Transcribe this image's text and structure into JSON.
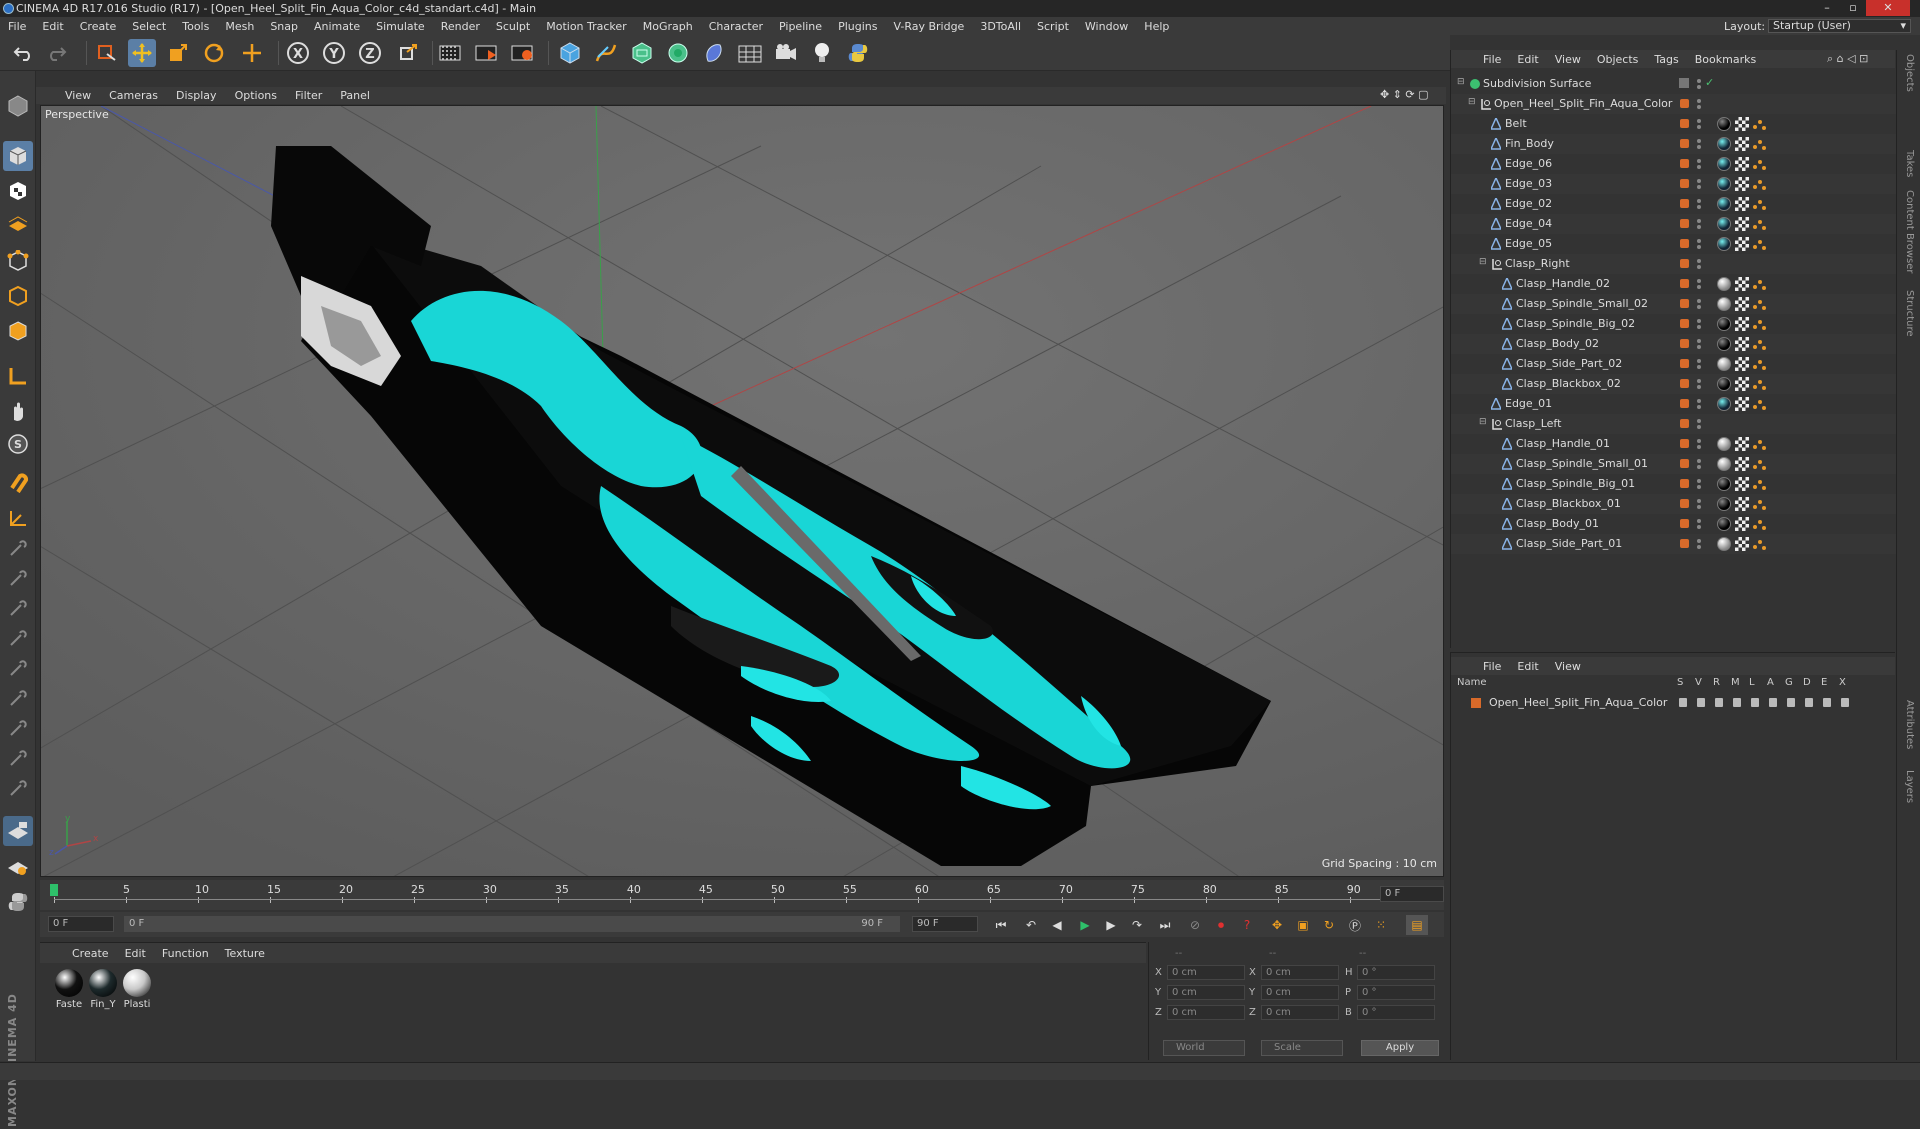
{
  "window": {
    "title": "CINEMA 4D R17.016 Studio (R17) - [Open_Heel_Split_Fin_Aqua_Color_c4d_standart.c4d] - Main",
    "controls": [
      "–",
      "▫",
      "✕"
    ]
  },
  "menu": [
    "File",
    "Edit",
    "Create",
    "Select",
    "Tools",
    "Mesh",
    "Snap",
    "Animate",
    "Simulate",
    "Render",
    "Sculpt",
    "Motion Tracker",
    "MoGraph",
    "Character",
    "Pipeline",
    "Plugins",
    "V-Ray Bridge",
    "3DToAll",
    "Script",
    "Window",
    "Help"
  ],
  "layout": {
    "label": "Layout:",
    "value": "Startup (User)"
  },
  "viewport": {
    "menu": [
      "View",
      "Cameras",
      "Display",
      "Options",
      "Filter",
      "Panel"
    ],
    "label": "Perspective",
    "grid_spacing": "Grid Spacing : 10 cm",
    "axis_labels": [
      "y",
      "x",
      "z"
    ]
  },
  "timeline": {
    "ticks": [
      "0",
      "5",
      "10",
      "15",
      "20",
      "25",
      "30",
      "35",
      "40",
      "45",
      "50",
      "55",
      "60",
      "65",
      "70",
      "75",
      "80",
      "85",
      "90"
    ],
    "current_frame": "0 F",
    "start_field": "0 F",
    "range_start": "0 F",
    "range_end": "90 F",
    "end_field": "90 F"
  },
  "material_panel": {
    "menu": [
      "Create",
      "Edit",
      "Function",
      "Texture"
    ],
    "materials": [
      {
        "name": "Faste",
        "color": "#111111"
      },
      {
        "name": "Fin_Y",
        "color": "#1d2a2c"
      },
      {
        "name": "Plasti",
        "color": "#c8c8c8"
      }
    ]
  },
  "coords": {
    "header": [
      "--",
      "--",
      "--"
    ],
    "rows": [
      {
        "a": "X",
        "av": "0 cm",
        "b": "X",
        "bv": "0 cm",
        "c": "H",
        "cv": "0 °"
      },
      {
        "a": "Y",
        "av": "0 cm",
        "b": "Y",
        "bv": "0 cm",
        "c": "P",
        "cv": "0 °"
      },
      {
        "a": "Z",
        "av": "0 cm",
        "b": "Z",
        "bv": "0 cm",
        "c": "B",
        "cv": "0 °"
      }
    ],
    "world": "World",
    "scale": "Scale",
    "apply": "Apply"
  },
  "object_manager": {
    "menu": [
      "File",
      "Edit",
      "View",
      "Objects",
      "Tags",
      "Bookmarks"
    ],
    "objects": [
      {
        "name": "Subdivision Surface",
        "depth": 0,
        "type": "sds",
        "tag": "none"
      },
      {
        "name": "Open_Heel_Split_Fin_Aqua_Color",
        "depth": 1,
        "type": "null",
        "tag": "none"
      },
      {
        "name": "Belt",
        "depth": 2,
        "type": "poly",
        "tag": "black"
      },
      {
        "name": "Fin_Body",
        "depth": 2,
        "type": "poly",
        "tag": "teal"
      },
      {
        "name": "Edge_06",
        "depth": 2,
        "type": "poly",
        "tag": "teal"
      },
      {
        "name": "Edge_03",
        "depth": 2,
        "type": "poly",
        "tag": "teal"
      },
      {
        "name": "Edge_02",
        "depth": 2,
        "type": "poly",
        "tag": "teal"
      },
      {
        "name": "Edge_04",
        "depth": 2,
        "type": "poly",
        "tag": "teal"
      },
      {
        "name": "Edge_05",
        "depth": 2,
        "type": "poly",
        "tag": "teal"
      },
      {
        "name": "Clasp_Right",
        "depth": 2,
        "type": "null",
        "tag": "none"
      },
      {
        "name": "Clasp_Handle_02",
        "depth": 3,
        "type": "poly",
        "tag": "grey"
      },
      {
        "name": "Clasp_Spindle_Small_02",
        "depth": 3,
        "type": "poly",
        "tag": "grey"
      },
      {
        "name": "Clasp_Spindle_Big_02",
        "depth": 3,
        "type": "poly",
        "tag": "black"
      },
      {
        "name": "Clasp_Body_02",
        "depth": 3,
        "type": "poly",
        "tag": "black"
      },
      {
        "name": "Clasp_Side_Part_02",
        "depth": 3,
        "type": "poly",
        "tag": "grey"
      },
      {
        "name": "Clasp_Blackbox_02",
        "depth": 3,
        "type": "poly",
        "tag": "black"
      },
      {
        "name": "Edge_01",
        "depth": 2,
        "type": "poly",
        "tag": "teal"
      },
      {
        "name": "Clasp_Left",
        "depth": 2,
        "type": "null",
        "tag": "none"
      },
      {
        "name": "Clasp_Handle_01",
        "depth": 3,
        "type": "poly",
        "tag": "grey"
      },
      {
        "name": "Clasp_Spindle_Small_01",
        "depth": 3,
        "type": "poly",
        "tag": "grey"
      },
      {
        "name": "Clasp_Spindle_Big_01",
        "depth": 3,
        "type": "poly",
        "tag": "black"
      },
      {
        "name": "Clasp_Blackbox_01",
        "depth": 3,
        "type": "poly",
        "tag": "black"
      },
      {
        "name": "Clasp_Body_01",
        "depth": 3,
        "type": "poly",
        "tag": "black"
      },
      {
        "name": "Clasp_Side_Part_01",
        "depth": 3,
        "type": "poly",
        "tag": "grey"
      }
    ]
  },
  "layer_manager": {
    "menu": [
      "File",
      "Edit",
      "View"
    ],
    "columns": [
      "Name",
      "S",
      "V",
      "R",
      "M",
      "L",
      "A",
      "G",
      "D",
      "E",
      "X"
    ],
    "layers": [
      {
        "name": "Open_Heel_Split_Fin_Aqua_Color",
        "color": "#d86a2a"
      }
    ]
  },
  "side_tabs": [
    "Objects",
    "Takes",
    "Content Browser",
    "Structure",
    "Attributes",
    "Layers"
  ],
  "colors": {
    "accent": "#5b7fa6",
    "aqua": "#19d6d6",
    "object_orange": "#d86a2a",
    "bg": "#333333"
  }
}
